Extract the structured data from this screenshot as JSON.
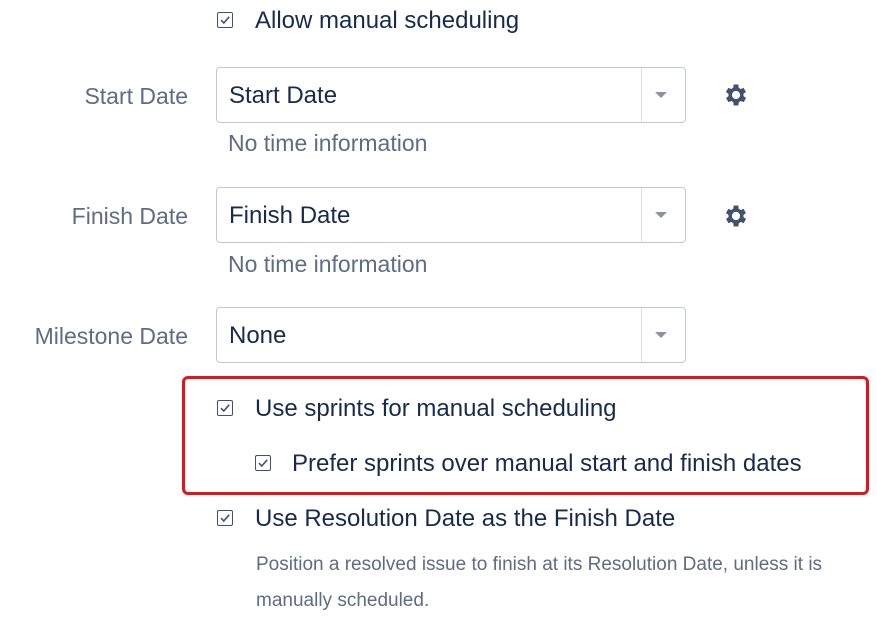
{
  "allow_manual_scheduling": {
    "label": "Allow manual scheduling",
    "checked": true
  },
  "start_date": {
    "label": "Start Date",
    "selected": "Start Date",
    "hint": "No time information",
    "settings_icon": "gear-icon"
  },
  "finish_date": {
    "label": "Finish Date",
    "selected": "Finish Date",
    "hint": "No time information",
    "settings_icon": "gear-icon"
  },
  "milestone_date": {
    "label": "Milestone Date",
    "selected": "None"
  },
  "use_sprints": {
    "label": "Use sprints for manual scheduling",
    "checked": true
  },
  "prefer_sprints": {
    "label": "Prefer sprints over manual start and finish dates",
    "checked": true
  },
  "use_resolution_date": {
    "label": "Use Resolution Date as the Finish Date",
    "checked": true,
    "description": "Position a resolved issue to finish at its Resolution Date, unless it is manually scheduled."
  },
  "colors": {
    "highlight": "#e3151a",
    "text": "#172b4d",
    "muted": "#5e6c84",
    "border": "#c1c7d0"
  }
}
